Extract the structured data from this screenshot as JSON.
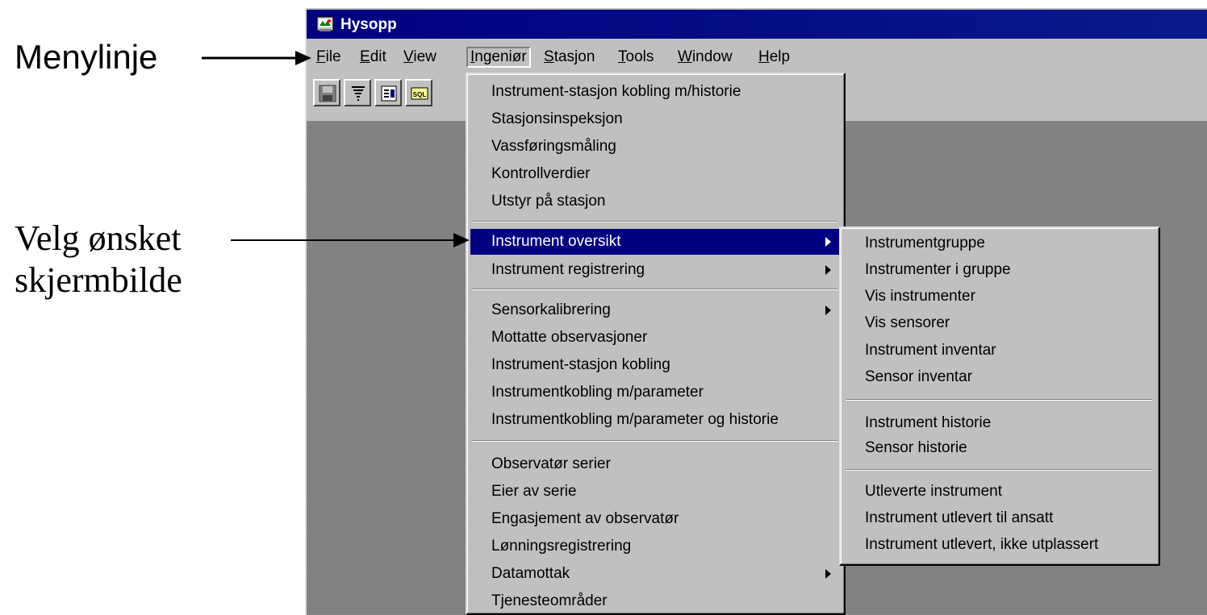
{
  "annotations": {
    "menu_bar_label": "Menylinje",
    "select_screen_line1": "Velg ønsket",
    "select_screen_line2": "skjermbilde"
  },
  "window": {
    "title": "Hysopp",
    "icon": "hysopp-app-icon"
  },
  "menubar": {
    "items": [
      {
        "label": "File",
        "accel": "F"
      },
      {
        "label": "Edit",
        "accel": "E"
      },
      {
        "label": "View",
        "accel": "V"
      },
      {
        "label": "Ingeniør",
        "accel": "I"
      },
      {
        "label": "Stasjon",
        "accel": "S"
      },
      {
        "label": "Tools",
        "accel": "T"
      },
      {
        "label": "Window",
        "accel": "W"
      },
      {
        "label": "Help",
        "accel": "H"
      }
    ],
    "active": "Ingeniør"
  },
  "toolbar": {
    "buttons": [
      "save-icon",
      "tornado-icon",
      "form-icon",
      "sql-icon"
    ],
    "sql_text": "SQL"
  },
  "ingenior_menu": {
    "group1": [
      "Instrument-stasjon kobling m/historie",
      "Stasjonsinspeksjon",
      "Vassføringsmåling",
      "Kontrollverdier",
      "Utstyr på stasjon"
    ],
    "group2": [
      {
        "label": "Instrument oversikt",
        "submenu": true,
        "highlighted": true
      },
      {
        "label": "Instrument registrering",
        "submenu": true
      }
    ],
    "group3": [
      {
        "label": "Sensorkalibrering",
        "submenu": true
      },
      {
        "label": "Mottatte observasjoner"
      },
      {
        "label": "Instrument-stasjon kobling"
      },
      {
        "label": "Instrumentkobling m/parameter"
      },
      {
        "label": "Instrumentkobling m/parameter og historie"
      }
    ],
    "group4": [
      {
        "label": "Observatør serier"
      },
      {
        "label": "Eier av serie"
      },
      {
        "label": "Engasjement av observatør"
      },
      {
        "label": "Lønningsregistrering"
      },
      {
        "label": "Datamottak",
        "submenu": true
      },
      {
        "label": "Tjenesteområder"
      }
    ]
  },
  "instrument_oversikt_submenu": {
    "group1": [
      "Instrumentgruppe",
      "Instrumenter i gruppe",
      "Vis instrumenter",
      "Vis sensorer",
      "Instrument inventar",
      "Sensor inventar"
    ],
    "group2": [
      "Instrument historie",
      "Sensor historie"
    ],
    "group3": [
      "Utleverte instrument",
      "Instrument utlevert til ansatt",
      "Instrument utlevert, ikke utplassert"
    ]
  }
}
